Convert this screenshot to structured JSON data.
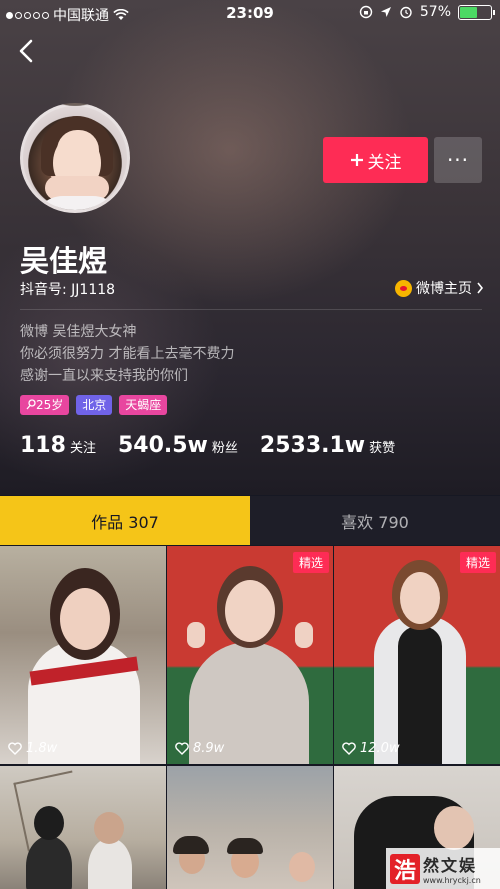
{
  "status_bar": {
    "carrier": "中国联通",
    "time": "23:09",
    "battery": "57%",
    "battery_level": 0.57
  },
  "profile": {
    "name": "吴佳煜",
    "douyin_id": "抖音号: JJ1118",
    "weibo_link": "微博主页",
    "follow_label": "关注",
    "more_label": "···",
    "bio_lines": [
      "微博  吴佳煜大女神",
      "你必须很努力 才能看上去毫不费力",
      "感谢一直以来支持我的你们"
    ],
    "tags": {
      "age": "25岁",
      "city": "北京",
      "zodiac": "天蝎座"
    }
  },
  "stats": {
    "following_num": "118",
    "following_label": "关注",
    "fans_num": "540.5w",
    "fans_label": "粉丝",
    "likes_num": "2533.1w",
    "likes_label": "获赞"
  },
  "tabs": {
    "works": "作品 307",
    "likes": "喜欢 790"
  },
  "videos": [
    {
      "likes": "1.8w",
      "badge": ""
    },
    {
      "likes": "8.9w",
      "badge": "精选"
    },
    {
      "likes": "12.0w",
      "badge": "精选"
    },
    {
      "likes": "",
      "badge": ""
    },
    {
      "likes": "",
      "badge": ""
    },
    {
      "likes": "",
      "badge": ""
    }
  ],
  "watermark": {
    "logo_char": "浩",
    "title": "然文娱",
    "url": "www.hryckj.cn"
  },
  "colors": {
    "accent_red": "#fe2c55",
    "tab_active": "#f5c518",
    "background": "#161823"
  }
}
